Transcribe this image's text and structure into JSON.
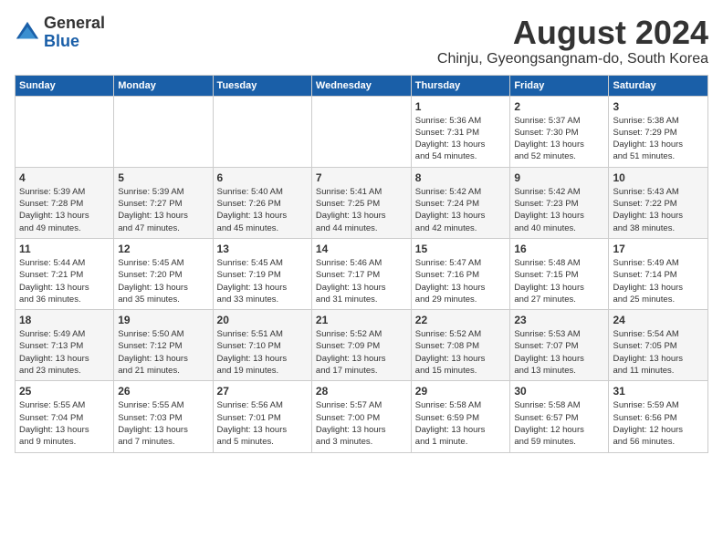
{
  "logo": {
    "general": "General",
    "blue": "Blue"
  },
  "title": "August 2024",
  "subtitle": "Chinju, Gyeongsangnam-do, South Korea",
  "days_of_week": [
    "Sunday",
    "Monday",
    "Tuesday",
    "Wednesday",
    "Thursday",
    "Friday",
    "Saturday"
  ],
  "weeks": [
    [
      {
        "day": "",
        "info": ""
      },
      {
        "day": "",
        "info": ""
      },
      {
        "day": "",
        "info": ""
      },
      {
        "day": "",
        "info": ""
      },
      {
        "day": "1",
        "info": "Sunrise: 5:36 AM\nSunset: 7:31 PM\nDaylight: 13 hours\nand 54 minutes."
      },
      {
        "day": "2",
        "info": "Sunrise: 5:37 AM\nSunset: 7:30 PM\nDaylight: 13 hours\nand 52 minutes."
      },
      {
        "day": "3",
        "info": "Sunrise: 5:38 AM\nSunset: 7:29 PM\nDaylight: 13 hours\nand 51 minutes."
      }
    ],
    [
      {
        "day": "4",
        "info": "Sunrise: 5:39 AM\nSunset: 7:28 PM\nDaylight: 13 hours\nand 49 minutes."
      },
      {
        "day": "5",
        "info": "Sunrise: 5:39 AM\nSunset: 7:27 PM\nDaylight: 13 hours\nand 47 minutes."
      },
      {
        "day": "6",
        "info": "Sunrise: 5:40 AM\nSunset: 7:26 PM\nDaylight: 13 hours\nand 45 minutes."
      },
      {
        "day": "7",
        "info": "Sunrise: 5:41 AM\nSunset: 7:25 PM\nDaylight: 13 hours\nand 44 minutes."
      },
      {
        "day": "8",
        "info": "Sunrise: 5:42 AM\nSunset: 7:24 PM\nDaylight: 13 hours\nand 42 minutes."
      },
      {
        "day": "9",
        "info": "Sunrise: 5:42 AM\nSunset: 7:23 PM\nDaylight: 13 hours\nand 40 minutes."
      },
      {
        "day": "10",
        "info": "Sunrise: 5:43 AM\nSunset: 7:22 PM\nDaylight: 13 hours\nand 38 minutes."
      }
    ],
    [
      {
        "day": "11",
        "info": "Sunrise: 5:44 AM\nSunset: 7:21 PM\nDaylight: 13 hours\nand 36 minutes."
      },
      {
        "day": "12",
        "info": "Sunrise: 5:45 AM\nSunset: 7:20 PM\nDaylight: 13 hours\nand 35 minutes."
      },
      {
        "day": "13",
        "info": "Sunrise: 5:45 AM\nSunset: 7:19 PM\nDaylight: 13 hours\nand 33 minutes."
      },
      {
        "day": "14",
        "info": "Sunrise: 5:46 AM\nSunset: 7:17 PM\nDaylight: 13 hours\nand 31 minutes."
      },
      {
        "day": "15",
        "info": "Sunrise: 5:47 AM\nSunset: 7:16 PM\nDaylight: 13 hours\nand 29 minutes."
      },
      {
        "day": "16",
        "info": "Sunrise: 5:48 AM\nSunset: 7:15 PM\nDaylight: 13 hours\nand 27 minutes."
      },
      {
        "day": "17",
        "info": "Sunrise: 5:49 AM\nSunset: 7:14 PM\nDaylight: 13 hours\nand 25 minutes."
      }
    ],
    [
      {
        "day": "18",
        "info": "Sunrise: 5:49 AM\nSunset: 7:13 PM\nDaylight: 13 hours\nand 23 minutes."
      },
      {
        "day": "19",
        "info": "Sunrise: 5:50 AM\nSunset: 7:12 PM\nDaylight: 13 hours\nand 21 minutes."
      },
      {
        "day": "20",
        "info": "Sunrise: 5:51 AM\nSunset: 7:10 PM\nDaylight: 13 hours\nand 19 minutes."
      },
      {
        "day": "21",
        "info": "Sunrise: 5:52 AM\nSunset: 7:09 PM\nDaylight: 13 hours\nand 17 minutes."
      },
      {
        "day": "22",
        "info": "Sunrise: 5:52 AM\nSunset: 7:08 PM\nDaylight: 13 hours\nand 15 minutes."
      },
      {
        "day": "23",
        "info": "Sunrise: 5:53 AM\nSunset: 7:07 PM\nDaylight: 13 hours\nand 13 minutes."
      },
      {
        "day": "24",
        "info": "Sunrise: 5:54 AM\nSunset: 7:05 PM\nDaylight: 13 hours\nand 11 minutes."
      }
    ],
    [
      {
        "day": "25",
        "info": "Sunrise: 5:55 AM\nSunset: 7:04 PM\nDaylight: 13 hours\nand 9 minutes."
      },
      {
        "day": "26",
        "info": "Sunrise: 5:55 AM\nSunset: 7:03 PM\nDaylight: 13 hours\nand 7 minutes."
      },
      {
        "day": "27",
        "info": "Sunrise: 5:56 AM\nSunset: 7:01 PM\nDaylight: 13 hours\nand 5 minutes."
      },
      {
        "day": "28",
        "info": "Sunrise: 5:57 AM\nSunset: 7:00 PM\nDaylight: 13 hours\nand 3 minutes."
      },
      {
        "day": "29",
        "info": "Sunrise: 5:58 AM\nSunset: 6:59 PM\nDaylight: 13 hours\nand 1 minute."
      },
      {
        "day": "30",
        "info": "Sunrise: 5:58 AM\nSunset: 6:57 PM\nDaylight: 12 hours\nand 59 minutes."
      },
      {
        "day": "31",
        "info": "Sunrise: 5:59 AM\nSunset: 6:56 PM\nDaylight: 12 hours\nand 56 minutes."
      }
    ]
  ]
}
